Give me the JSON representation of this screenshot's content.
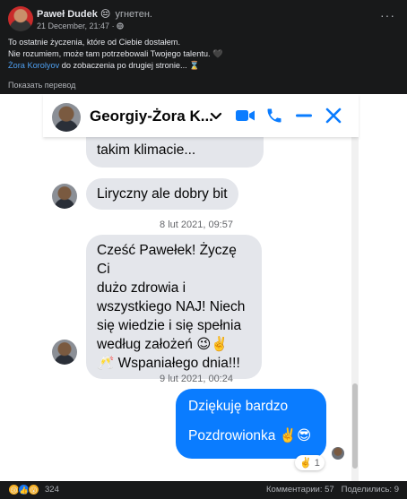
{
  "post": {
    "author": "Paweł Dudek",
    "mood_emoji": "😔",
    "feeling": "угнетен.",
    "timestamp": "21 December, 21:47",
    "visibility_separator": "·",
    "menu_icon": "more-dots-icon",
    "text_line1": "To ostatnie życzenia, które od Ciebie dostałem.",
    "text_line2": "Nie rozumiem, może tam potrzebowali Twojego talentu. 🖤",
    "mention": "Żora Korolyov",
    "text_line3_rest": " do zobaczenia po drugiej stronie... ⌛",
    "translate_label": "Показать перевод"
  },
  "chat": {
    "contact_name": "Georgiy-Żora K...",
    "accent": "#0a7cff",
    "header_icons": [
      "chevron-down-icon",
      "video-call-icon",
      "phone-icon",
      "minimize-icon",
      "close-icon"
    ],
    "messages": [
      {
        "dir": "in",
        "text": "takim klimacie..."
      },
      {
        "dir": "in",
        "text": "Liryczny ale dobry bit"
      },
      {
        "dir": "time",
        "text": "8 lut 2021, 09:57"
      },
      {
        "dir": "in",
        "lines": [
          "Cześć Pawełek! Życzę Ci",
          "dużo zdrowia i",
          "wszystkiego NAJ! Niech",
          "się wiedzie i się spełnia",
          "według założeń 😉✌️",
          "🥂 Wspaniałego dnia!!!"
        ]
      },
      {
        "dir": "time",
        "text": "9 lut 2021, 00:24"
      },
      {
        "dir": "out",
        "lines": [
          "Dziękuję bardzo",
          "",
          "Pozdrowionka ✌️😎"
        ]
      }
    ],
    "reaction": {
      "emoji": "✌️",
      "count": "1"
    }
  },
  "footer": {
    "reaction_icons": [
      "😢",
      "👍",
      "😮"
    ],
    "reaction_count": "324",
    "comments": "Комментарии: 57",
    "shares": "Поделились: 9"
  }
}
